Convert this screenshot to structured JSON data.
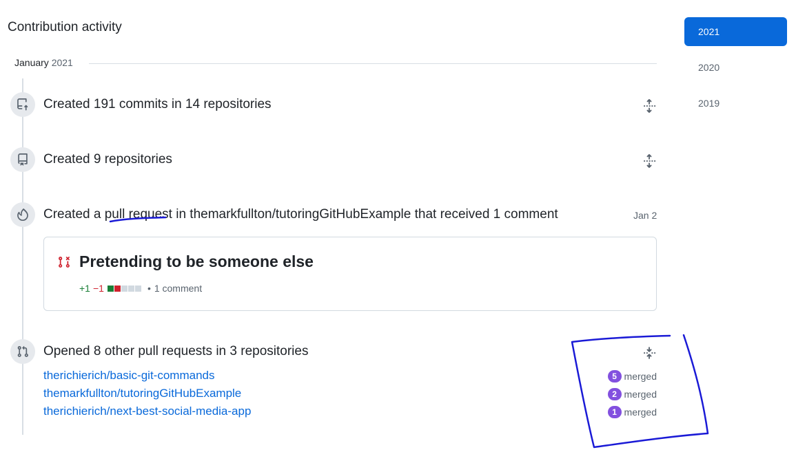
{
  "heading": "Contribution activity",
  "month": {
    "name": "January",
    "year": "2021"
  },
  "timeline": {
    "commits": {
      "title": "Created 191 commits in 14 repositories",
      "icon": "repo-push-icon"
    },
    "repos": {
      "title": "Created 9 repositories",
      "icon": "repo-icon"
    },
    "pr_created": {
      "title": "Created a pull request in themarkfullton/tutoringGitHubExample that received 1 comment",
      "icon": "flame-icon",
      "date": "Jan 2",
      "card": {
        "title": "Pretending to be someone else",
        "additions": "+1",
        "deletions": "−1",
        "separator": "•",
        "comments": "1 comment"
      }
    },
    "prs_opened": {
      "title": "Opened 8 other pull requests in 3 repositories",
      "icon": "git-pull-request-icon",
      "repos": [
        {
          "name": "therichierich/basic-git-commands",
          "count": "5",
          "status": "merged"
        },
        {
          "name": "themarkfullton/tutoringGitHubExample",
          "count": "2",
          "status": "merged"
        },
        {
          "name": "therichierich/next-best-social-media-app",
          "count": "1",
          "status": "merged"
        }
      ]
    }
  },
  "years": [
    "2021",
    "2020",
    "2019"
  ],
  "colors": {
    "accent": "#0969da",
    "merged": "#8250df",
    "addition": "#1a7f37",
    "deletion": "#cf222e",
    "annotation": "#1a1ad6"
  }
}
